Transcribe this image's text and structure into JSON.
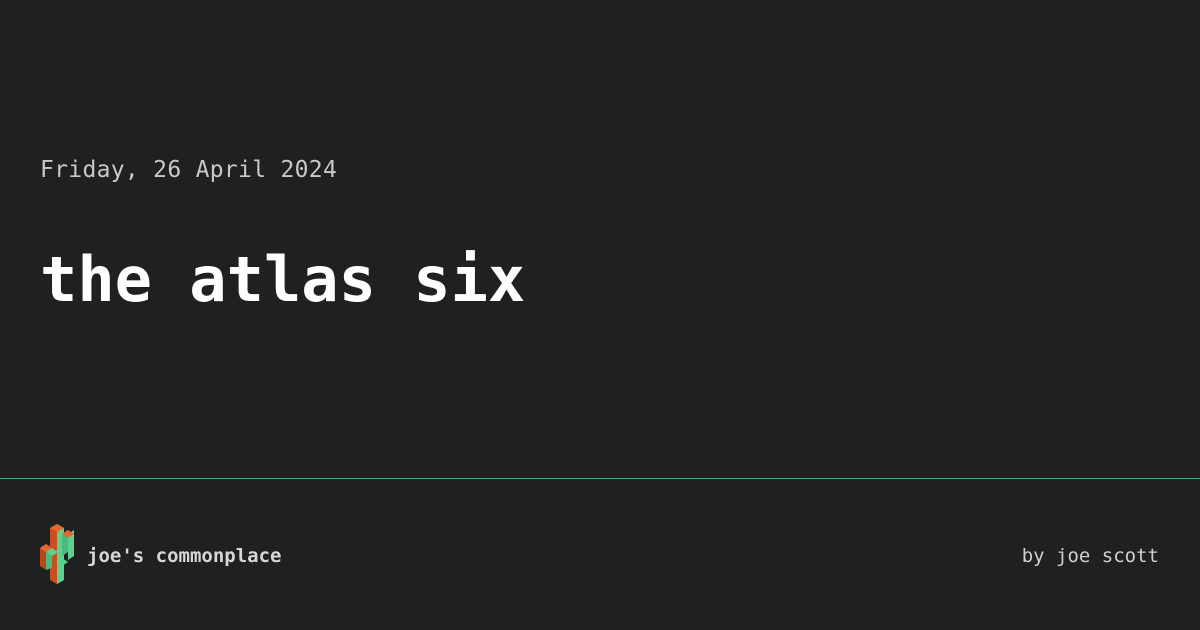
{
  "post": {
    "date": "Friday, 26 April 2024",
    "title": "the atlas six"
  },
  "footer": {
    "site_name": "joe's commonplace",
    "byline": "by joe scott",
    "logo_icon": "cactus-icon"
  },
  "colors": {
    "background": "#1f2022",
    "divider": "#3fae7c",
    "logo_green": "#5fcf8e",
    "logo_orange": "#d85a1e"
  }
}
